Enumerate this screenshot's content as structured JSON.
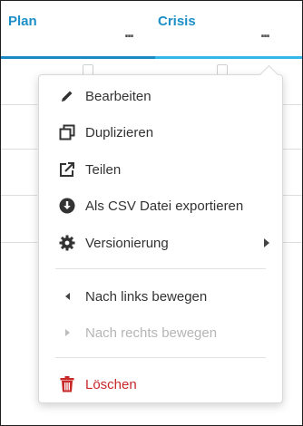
{
  "columns": [
    {
      "title": "Plan",
      "more": "..."
    },
    {
      "title": "Crisis",
      "more": "..."
    }
  ],
  "menu": {
    "items": [
      {
        "label": "Bearbeiten",
        "icon": "pencil-icon"
      },
      {
        "label": "Duplizieren",
        "icon": "duplicate-icon"
      },
      {
        "label": "Teilen",
        "icon": "share-icon"
      },
      {
        "label": "Als CSV Datei exportieren",
        "icon": "download-circle-icon"
      },
      {
        "label": "Versionierung",
        "icon": "gear-icon",
        "has_submenu": true
      },
      {
        "label": "Nach links bewegen",
        "icon": "arrow-left-icon"
      },
      {
        "label": "Nach rechts bewegen",
        "icon": "arrow-right-icon",
        "disabled": true
      },
      {
        "label": "Löschen",
        "icon": "trash-icon",
        "danger": true
      }
    ]
  },
  "colors": {
    "accent": "#1d8fc7",
    "plan_underline": "#1b8ac2",
    "crisis_underline": "#34b7e8",
    "danger": "#c82828",
    "disabled": "#b5b5b5"
  }
}
